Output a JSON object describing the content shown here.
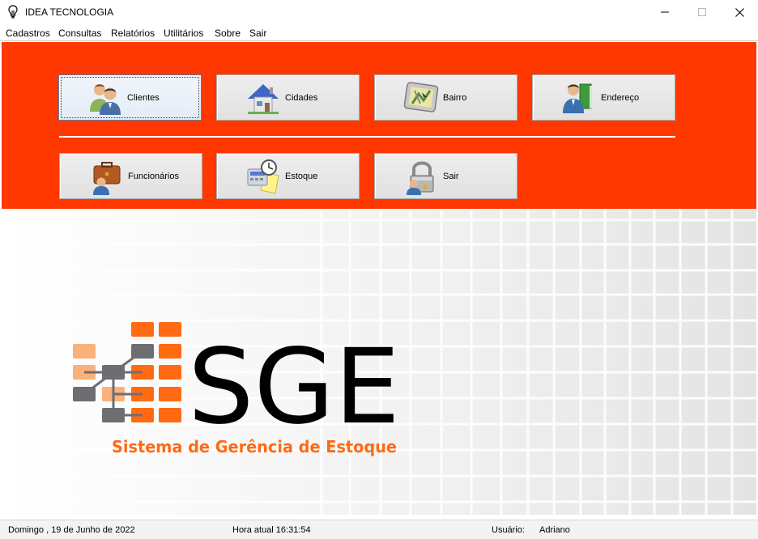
{
  "window": {
    "title": "IDEA TECNOLOGIA",
    "minimize_icon": "minimize-icon",
    "maximize_icon": "maximize-icon",
    "close_icon": "close-icon"
  },
  "menu": {
    "items": [
      {
        "label": "Cadastros"
      },
      {
        "label": "Consultas"
      },
      {
        "label": "Relatórios"
      },
      {
        "label": "Utilitários"
      },
      {
        "label": "Sobre"
      },
      {
        "label": "Sair"
      }
    ]
  },
  "toolbar": {
    "accent_color": "#ff3700",
    "buttons": [
      {
        "label": "Clientes",
        "icon": "users-icon"
      },
      {
        "label": "Cidades",
        "icon": "house-icon"
      },
      {
        "label": "Bairro",
        "icon": "gps-map-icon"
      },
      {
        "label": "Endereço",
        "icon": "person-book-icon"
      },
      {
        "label": "Funcionários",
        "icon": "briefcase-person-icon"
      },
      {
        "label": "Estoque",
        "icon": "calculator-clock-icon"
      },
      {
        "label": "Sair",
        "icon": "padlock-user-icon"
      }
    ]
  },
  "logo": {
    "title": "SGE",
    "subtitle": "Sistema de Gerência de Estoque",
    "orange": "#ff6a13",
    "light_orange": "#fbb17a",
    "gray": "#6d6e71"
  },
  "status": {
    "date": "Domingo , 19 de Junho de 2022",
    "time": "Hora atual 16:31:54",
    "user_label": "Usuário:",
    "user_name": "Adriano"
  }
}
